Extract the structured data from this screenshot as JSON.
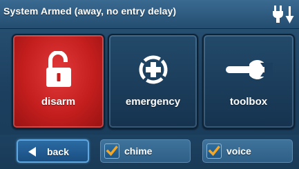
{
  "header": {
    "title": "System Armed (away, no entry delay)",
    "power_icon": "ac-power-plug-icon"
  },
  "tiles": [
    {
      "label": "disarm",
      "icon": "open-padlock-icon",
      "color": "#c41e1e"
    },
    {
      "label": "emergency",
      "icon": "emergency-cross-icon",
      "color": "#1c3f5f"
    },
    {
      "label": "toolbox",
      "icon": "wrench-icon",
      "color": "#1c3f5f"
    }
  ],
  "bottom": {
    "back_label": "back",
    "chime": {
      "label": "chime",
      "checked": true
    },
    "voice": {
      "label": "voice",
      "checked": true
    }
  },
  "colors": {
    "accent_orange": "#f5a623",
    "background": "#1c3f5f"
  }
}
